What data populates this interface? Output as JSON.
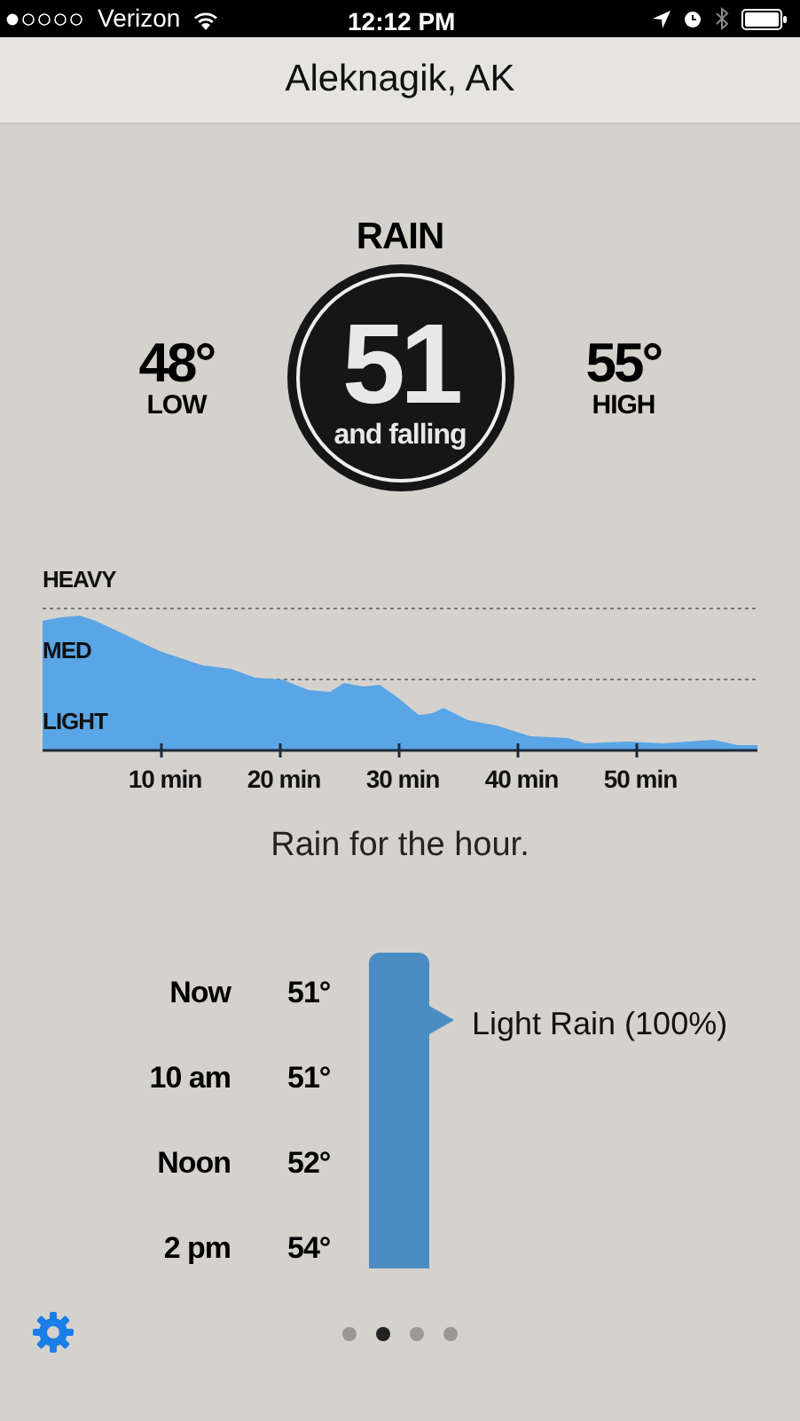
{
  "status_bar": {
    "carrier": "Verizon",
    "time": "12:12 PM"
  },
  "header": {
    "title": "Aleknagik, AK"
  },
  "current": {
    "condition": "RAIN",
    "temperature": "51",
    "trend": "and falling",
    "low": {
      "value": "48°",
      "label": "LOW"
    },
    "high": {
      "value": "55°",
      "label": "HIGH"
    }
  },
  "rain_graph": {
    "levels": [
      "HEAVY",
      "MED",
      "LIGHT"
    ],
    "times": [
      "10 min",
      "20 min",
      "30 min",
      "40 min",
      "50 min"
    ]
  },
  "summary": "Rain for the hour.",
  "hourly": [
    {
      "time": "Now",
      "temp": "51°"
    },
    {
      "time": "10 am",
      "temp": "51°"
    },
    {
      "time": "Noon",
      "temp": "52°"
    },
    {
      "time": "2 pm",
      "temp": "54°"
    }
  ],
  "conditions": [
    {
      "label": "Light Rain (100%)"
    }
  ],
  "pages": [
    {
      "selected": false
    },
    {
      "selected": true
    },
    {
      "selected": false
    },
    {
      "selected": false
    }
  ]
}
